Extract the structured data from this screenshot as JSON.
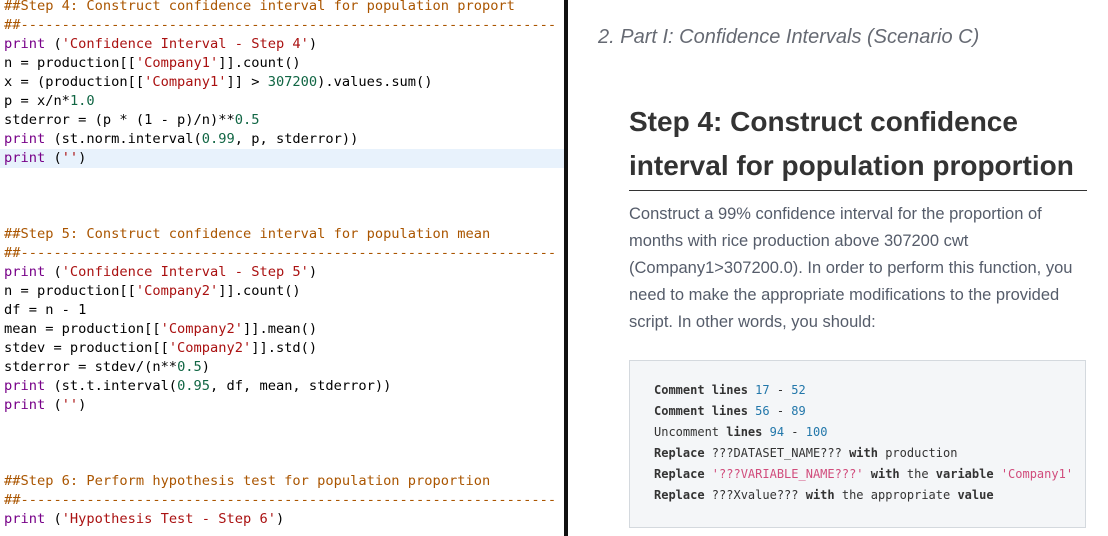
{
  "editor": {
    "lines": [
      [
        [
          "c",
          "##Step 4: Construct confidence interval for population proport"
        ]
      ],
      [
        [
          "c",
          "##-----------------------------------------------------------------"
        ]
      ],
      [
        [
          "k",
          "print"
        ],
        [
          "p",
          " ("
        ],
        [
          "s",
          "'Confidence Interval - Step 4'"
        ],
        [
          "p",
          ")"
        ]
      ],
      [
        [
          "p",
          "n = production[["
        ],
        [
          "s",
          "'Company1'"
        ],
        [
          "p",
          "]].count()"
        ]
      ],
      [
        [
          "p",
          "x = (production[["
        ],
        [
          "s",
          "'Company1'"
        ],
        [
          "p",
          "]] > "
        ],
        [
          "n",
          "307200"
        ],
        [
          "p",
          ").values.sum()"
        ]
      ],
      [
        [
          "p",
          "p = x/n*"
        ],
        [
          "n",
          "1.0"
        ]
      ],
      [
        [
          "p",
          "stderror = (p * (1 - p)/n)**"
        ],
        [
          "n",
          "0.5"
        ]
      ],
      [
        [
          "k",
          "print"
        ],
        [
          "p",
          " (st.norm.interval("
        ],
        [
          "n",
          "0.99"
        ],
        [
          "p",
          ", p, stderror))"
        ]
      ],
      [
        [
          "k",
          "print"
        ],
        [
          "p",
          " ("
        ],
        [
          "s",
          "''"
        ],
        [
          "p",
          ")"
        ]
      ],
      [],
      [],
      [],
      [
        [
          "c",
          "##Step 5: Construct confidence interval for population mean"
        ]
      ],
      [
        [
          "c",
          "##-----------------------------------------------------------------"
        ]
      ],
      [
        [
          "k",
          "print"
        ],
        [
          "p",
          " ("
        ],
        [
          "s",
          "'Confidence Interval - Step 5'"
        ],
        [
          "p",
          ")"
        ]
      ],
      [
        [
          "p",
          "n = production[["
        ],
        [
          "s",
          "'Company2'"
        ],
        [
          "p",
          "]].count()"
        ]
      ],
      [
        [
          "p",
          "df = n - 1"
        ]
      ],
      [
        [
          "p",
          "mean = production[["
        ],
        [
          "s",
          "'Company2'"
        ],
        [
          "p",
          "]].mean()"
        ]
      ],
      [
        [
          "p",
          "stdev = production[["
        ],
        [
          "s",
          "'Company2'"
        ],
        [
          "p",
          "]].std()"
        ]
      ],
      [
        [
          "p",
          "stderror = stdev/(n**"
        ],
        [
          "n",
          "0.5"
        ],
        [
          "p",
          ")"
        ]
      ],
      [
        [
          "k",
          "print"
        ],
        [
          "p",
          " (st.t.interval("
        ],
        [
          "n",
          "0.95"
        ],
        [
          "p",
          ", df, mean, stderror))"
        ]
      ],
      [
        [
          "k",
          "print"
        ],
        [
          "p",
          " ("
        ],
        [
          "s",
          "''"
        ],
        [
          "p",
          ")"
        ]
      ],
      [],
      [],
      [],
      [
        [
          "c",
          "##Step 6: Perform hypothesis test for population proportion"
        ]
      ],
      [
        [
          "c",
          "##-----------------------------------------------------------------"
        ]
      ],
      [
        [
          "k",
          "print"
        ],
        [
          "p",
          " ("
        ],
        [
          "s",
          "'Hypothesis Test - Step 6'"
        ],
        [
          "p",
          ")"
        ]
      ]
    ],
    "active_line": 8
  },
  "doc": {
    "section_title": "2. Part I: Confidence Intervals (Scenario C)",
    "step_heading": "Step 4: Construct confidence interval for population proportion",
    "step_description": "Construct a 99% confidence interval for the proportion of months with rice production above 307200 cwt (Company1>307200.0). In order to perform this function, you need to make the appropriate modifications to the provided script. In other words, you should:",
    "instructions": [
      [
        [
          "k",
          "Comment lines "
        ],
        [
          "n",
          "17"
        ],
        [
          "p",
          " - "
        ],
        [
          "n",
          "52"
        ]
      ],
      [
        [
          "k",
          "Comment lines "
        ],
        [
          "n",
          "56"
        ],
        [
          "p",
          " - "
        ],
        [
          "n",
          "89"
        ]
      ],
      [
        [
          "p",
          "Uncomment "
        ],
        [
          "k",
          "lines "
        ],
        [
          "n",
          "94"
        ],
        [
          "p",
          " - "
        ],
        [
          "n",
          "100"
        ]
      ],
      [
        [
          "k",
          "Replace "
        ],
        [
          "p",
          "???DATASET_NAME??? "
        ],
        [
          "k",
          "with "
        ],
        [
          "p",
          "production"
        ]
      ],
      [
        [
          "k",
          "Replace "
        ],
        [
          "s",
          "'???VARIABLE_NAME???'"
        ],
        [
          "k",
          " with "
        ],
        [
          "p",
          "the "
        ],
        [
          "k",
          "variable "
        ],
        [
          "s",
          "'Company1'"
        ]
      ],
      [
        [
          "k",
          "Replace "
        ],
        [
          "p",
          "???Xvalue??? "
        ],
        [
          "k",
          "with "
        ],
        [
          "p",
          "the appropriate "
        ],
        [
          "k",
          "value"
        ]
      ]
    ]
  },
  "colors": {
    "code_comment": "#aa5500",
    "code_string": "#aa1111",
    "code_number": "#116644",
    "code_keyword": "#770088",
    "active_line_bg": "#e8f2fc",
    "divider": "#111111",
    "section_title": "#666a73",
    "heading": "#333333",
    "body_text": "#555c6a",
    "box_bg": "#f4f6f8",
    "box_number": "#2277aa",
    "box_string": "#d14c7c"
  }
}
